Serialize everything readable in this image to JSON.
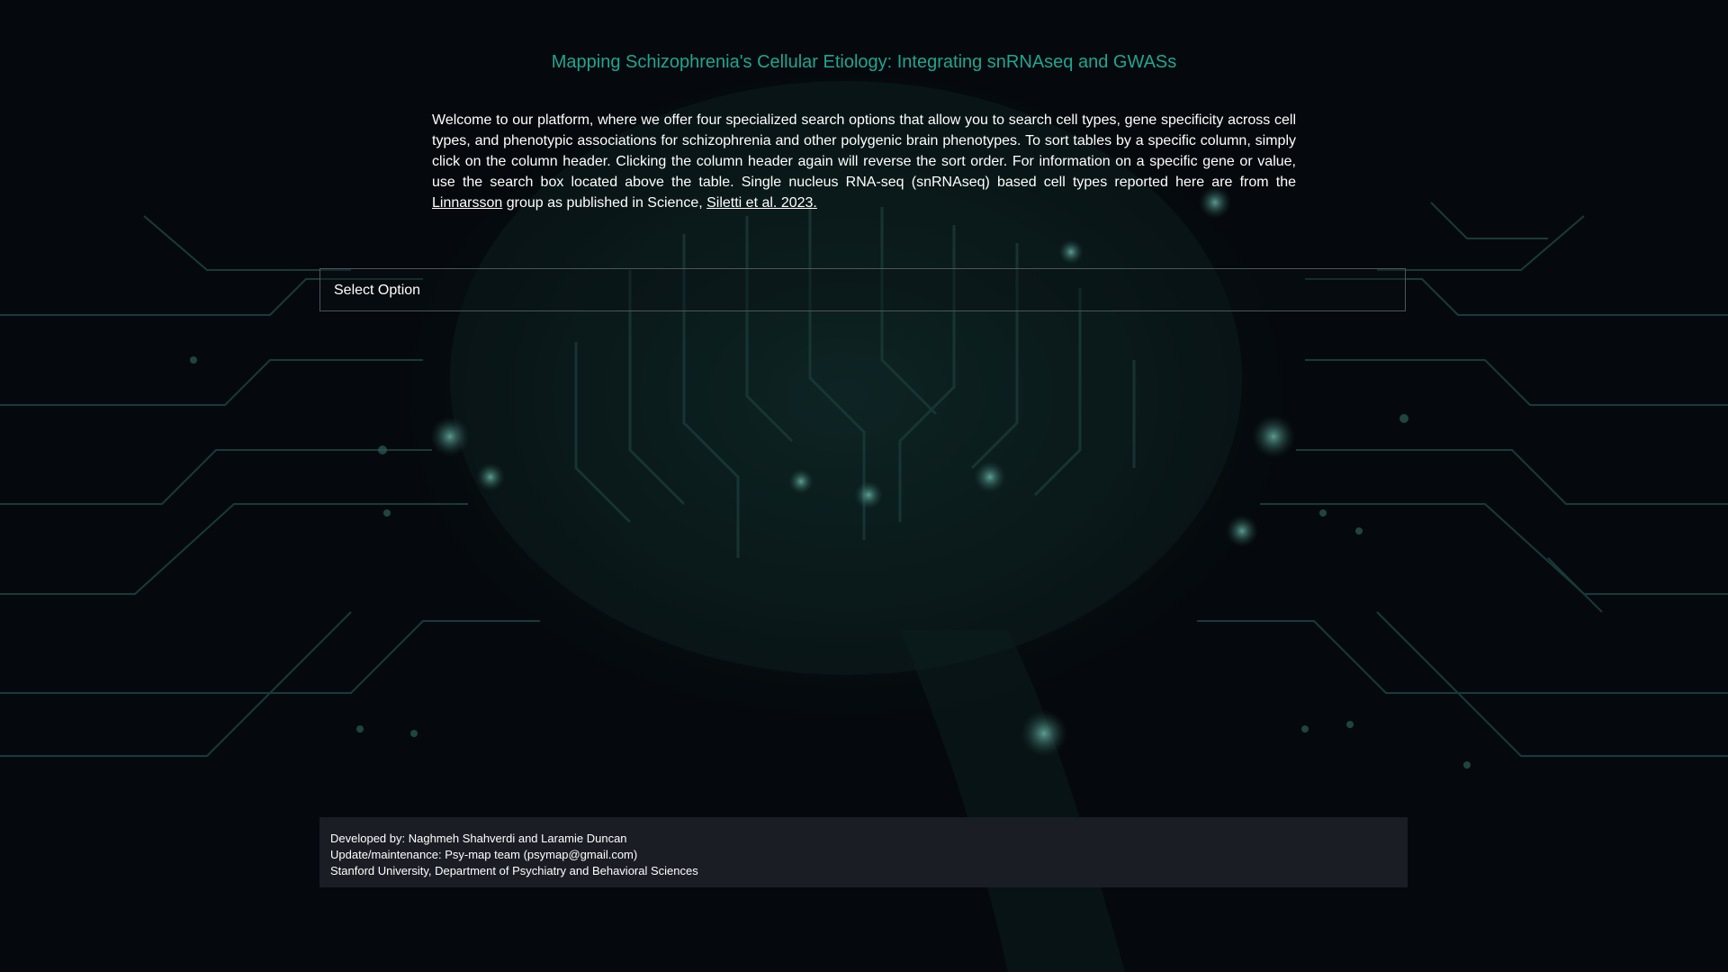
{
  "header": {
    "title": "Mapping Schizophrenia's Cellular Etiology: Integrating snRNAseq and GWASs"
  },
  "intro": {
    "text": "Welcome to our platform, where we offer four specialized search options that allow you to search cell types, gene specificity across cell types, and phenotypic associations for schizophrenia and other polygenic brain phenotypes. To sort tables by a specific column, simply click on the column header. Clicking the column header again will reverse the sort order. For information on a specific gene or value, use the search box located above the table. Single nucleus RNA-seq (snRNAseq) based cell types reported here are from the",
    "link1": "Linnarsson",
    "middle": "group as published in Science,",
    "link2": "Siletti et al. 2023."
  },
  "select": {
    "placeholder": "Select Option"
  },
  "footer": {
    "developed_by": "Developed by: Naghmeh Shahverdi and Laramie Duncan",
    "maintenance": "Update/maintenance: Psy-map team (psymap@gmail.com)",
    "affiliation": "Stanford University, Department of Psychiatry and Behavioral Sciences"
  },
  "theme": {
    "background": "#05090d",
    "accent": "#21a590",
    "circuit": "#1e4a46"
  }
}
